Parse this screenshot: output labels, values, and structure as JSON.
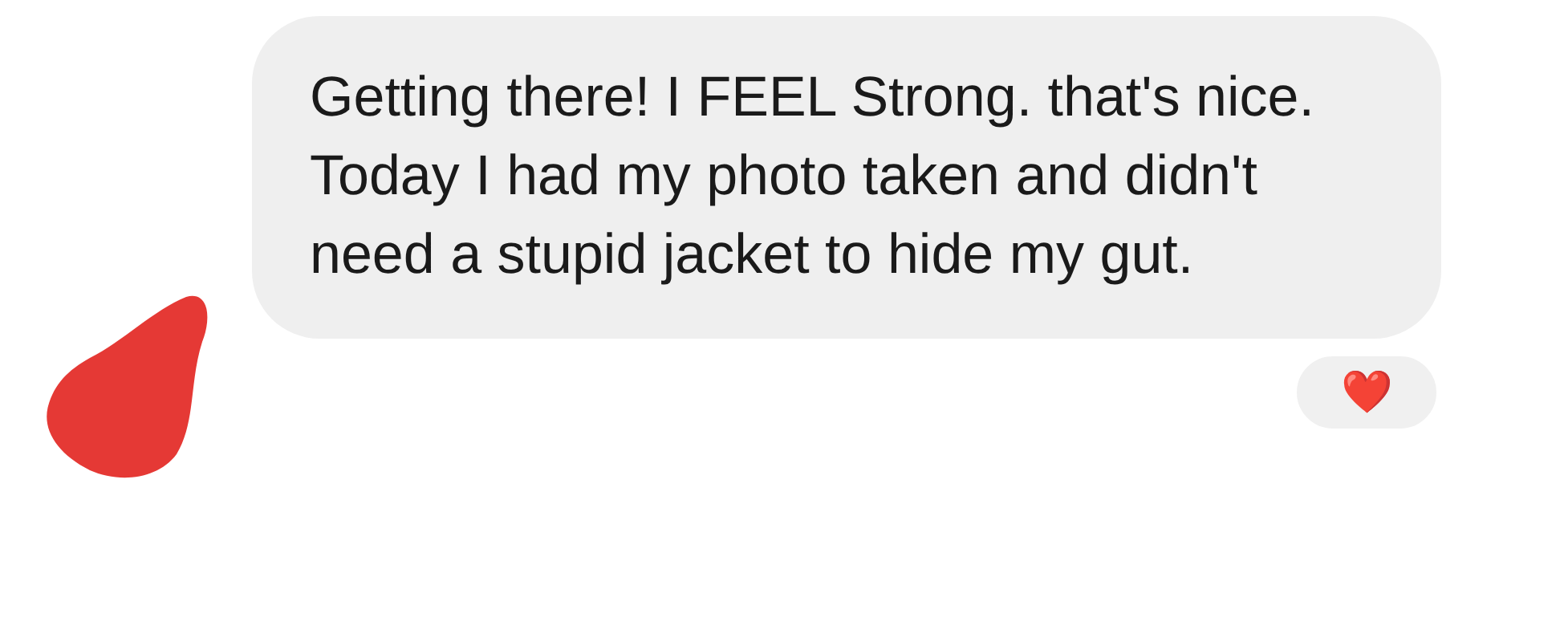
{
  "message": {
    "text": "Getting there! I FEEL Strong. that's nice. Today I had my photo taken and didn't need a stupid jacket to hide my gut.",
    "reaction": "❤️"
  }
}
